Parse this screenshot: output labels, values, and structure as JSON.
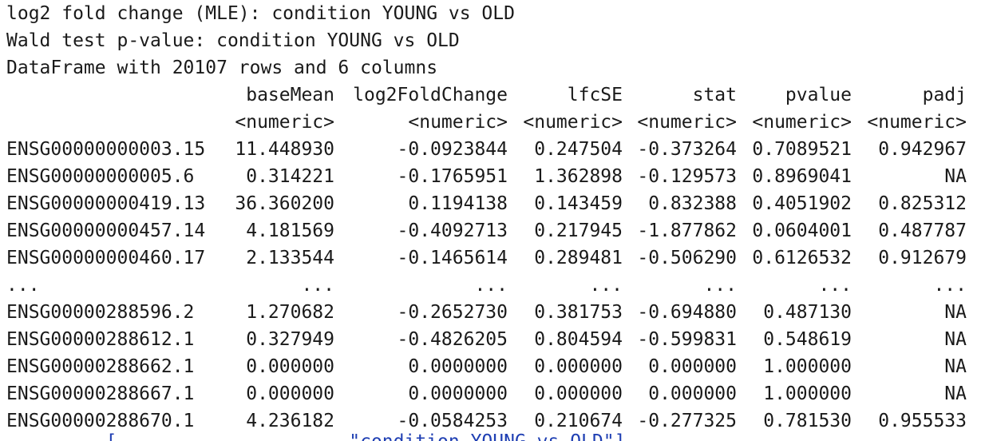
{
  "header": [
    "log2 fold change (MLE): condition YOUNG vs OLD",
    "Wald test p-value: condition YOUNG vs OLD",
    "DataFrame with 20107 rows and 6 columns"
  ],
  "table": {
    "columns": [
      "",
      "baseMean",
      "log2FoldChange",
      "lfcSE",
      "stat",
      "pvalue",
      "padj"
    ],
    "types": [
      "",
      "<numeric>",
      "<numeric>",
      "<numeric>",
      "<numeric>",
      "<numeric>",
      "<numeric>"
    ],
    "rows": [
      [
        "ENSG00000000003.15",
        "11.448930",
        "-0.0923844",
        "0.247504",
        "-0.373264",
        "0.7089521",
        "0.942967"
      ],
      [
        "ENSG00000000005.6",
        "0.314221",
        "-0.1765951",
        "1.362898",
        "-0.129573",
        "0.8969041",
        "NA"
      ],
      [
        "ENSG00000000419.13",
        "36.360200",
        "0.1194138",
        "0.143459",
        "0.832388",
        "0.4051902",
        "0.825312"
      ],
      [
        "ENSG00000000457.14",
        "4.181569",
        "-0.4092713",
        "0.217945",
        "-1.877862",
        "0.0604001",
        "0.487787"
      ],
      [
        "ENSG00000000460.17",
        "2.133544",
        "-0.1465614",
        "0.289481",
        "-0.506290",
        "0.6126532",
        "0.912679"
      ],
      [
        "...",
        "...",
        "...",
        "...",
        "...",
        "...",
        "..."
      ],
      [
        "ENSG00000288596.2",
        "1.270682",
        "-0.2652730",
        "0.381753",
        "-0.694880",
        "0.487130",
        "NA"
      ],
      [
        "ENSG00000288612.1",
        "0.327949",
        "-0.4826205",
        "0.804594",
        "-0.599831",
        "0.548619",
        "NA"
      ],
      [
        "ENSG00000288662.1",
        "0.000000",
        "0.0000000",
        "0.000000",
        "0.000000",
        "1.000000",
        "NA"
      ],
      [
        "ENSG00000288667.1",
        "0.000000",
        "0.0000000",
        "0.000000",
        "0.000000",
        "1.000000",
        "NA"
      ],
      [
        "ENSG00000288670.1",
        "4.236182",
        "-0.0584253",
        "0.210674",
        "-0.277325",
        "0.781530",
        "0.955533"
      ]
    ]
  },
  "next_command": "         [...  ...        ...  \"condition YOUNG vs OLD\"]"
}
